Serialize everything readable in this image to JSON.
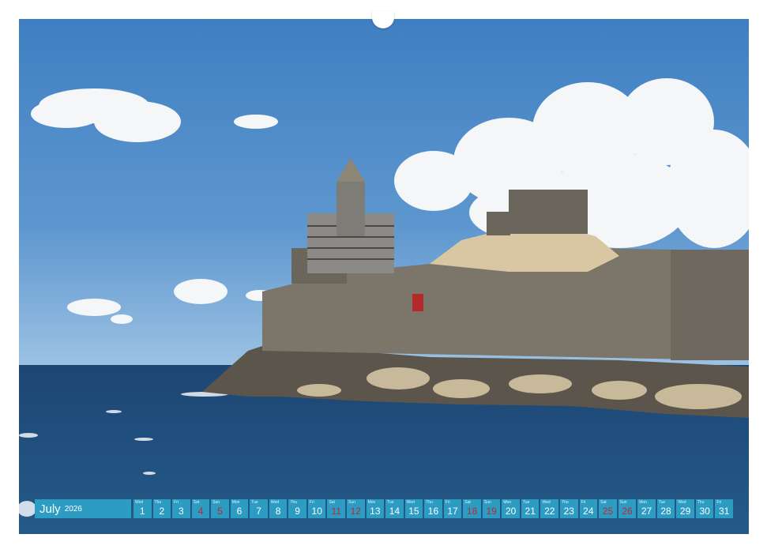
{
  "calendar": {
    "month": "July",
    "year": "2026",
    "days": [
      {
        "wd": "Wed",
        "num": "1",
        "weekend": false
      },
      {
        "wd": "Thu",
        "num": "2",
        "weekend": false
      },
      {
        "wd": "Fri",
        "num": "3",
        "weekend": false
      },
      {
        "wd": "Sat",
        "num": "4",
        "weekend": true
      },
      {
        "wd": "Sun",
        "num": "5",
        "weekend": true
      },
      {
        "wd": "Mon",
        "num": "6",
        "weekend": false
      },
      {
        "wd": "Tue",
        "num": "7",
        "weekend": false
      },
      {
        "wd": "Wed",
        "num": "8",
        "weekend": false
      },
      {
        "wd": "Thu",
        "num": "9",
        "weekend": false
      },
      {
        "wd": "Fri",
        "num": "10",
        "weekend": false
      },
      {
        "wd": "Sat",
        "num": "11",
        "weekend": true
      },
      {
        "wd": "Sun",
        "num": "12",
        "weekend": true
      },
      {
        "wd": "Mon",
        "num": "13",
        "weekend": false
      },
      {
        "wd": "Tue",
        "num": "14",
        "weekend": false
      },
      {
        "wd": "Wed",
        "num": "15",
        "weekend": false
      },
      {
        "wd": "Thu",
        "num": "16",
        "weekend": false
      },
      {
        "wd": "Fri",
        "num": "17",
        "weekend": false
      },
      {
        "wd": "Sat",
        "num": "18",
        "weekend": true
      },
      {
        "wd": "Sun",
        "num": "19",
        "weekend": true
      },
      {
        "wd": "Mon",
        "num": "20",
        "weekend": false
      },
      {
        "wd": "Tue",
        "num": "21",
        "weekend": false
      },
      {
        "wd": "Wed",
        "num": "22",
        "weekend": false
      },
      {
        "wd": "Thu",
        "num": "23",
        "weekend": false
      },
      {
        "wd": "Fri",
        "num": "24",
        "weekend": false
      },
      {
        "wd": "Sat",
        "num": "25",
        "weekend": true
      },
      {
        "wd": "Sun",
        "num": "26",
        "weekend": true
      },
      {
        "wd": "Mon",
        "num": "27",
        "weekend": false
      },
      {
        "wd": "Tue",
        "num": "28",
        "weekend": false
      },
      {
        "wd": "Wed",
        "num": "29",
        "weekend": false
      },
      {
        "wd": "Thu",
        "num": "30",
        "weekend": false
      },
      {
        "wd": "Fri",
        "num": "31",
        "weekend": false
      }
    ]
  },
  "colors": {
    "strip": "#2c9cc2",
    "weekend_number": "#c1272d",
    "sky": "#4a86c6",
    "sea": "#1f4b79"
  }
}
